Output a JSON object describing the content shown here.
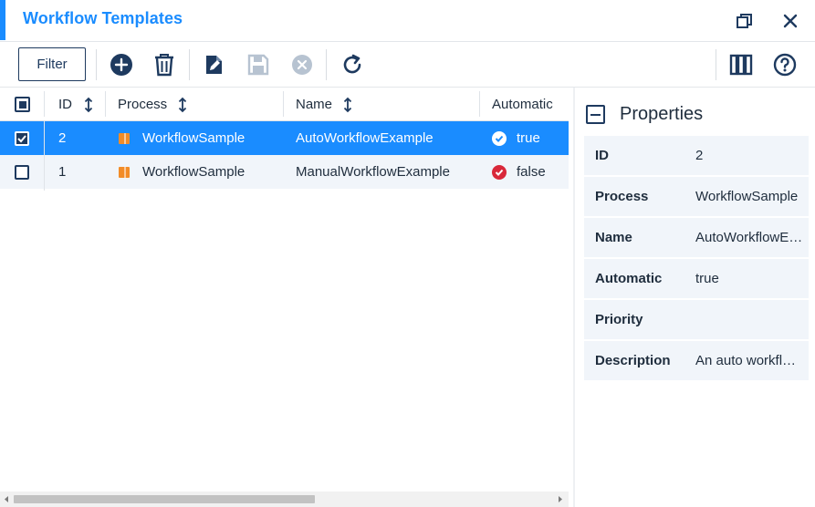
{
  "window": {
    "title": "Workflow Templates"
  },
  "toolbar": {
    "filter_label": "Filter"
  },
  "grid": {
    "columns": [
      "ID",
      "Process",
      "Name",
      "Automatic"
    ],
    "rows": [
      {
        "id": "2",
        "process": "WorkflowSample",
        "name": "AutoWorkflowExample",
        "automatic": "true",
        "checked": true
      },
      {
        "id": "1",
        "process": "WorkflowSample",
        "name": "ManualWorkflowExample",
        "automatic": "false",
        "checked": false
      }
    ]
  },
  "properties": {
    "title": "Properties",
    "items": [
      {
        "label": "ID",
        "value": "2"
      },
      {
        "label": "Process",
        "value": "WorkflowSample"
      },
      {
        "label": "Name",
        "value": "AutoWorkflowExample"
      },
      {
        "label": "Automatic",
        "value": "true"
      },
      {
        "label": "Priority",
        "value": ""
      },
      {
        "label": "Description",
        "value": "An auto workflow example"
      }
    ]
  },
  "colors": {
    "accent": "#1a8cff",
    "dark": "#1e3a5f",
    "success": "#1a8cff",
    "error": "#d9283a",
    "process_icon": "#f28c28"
  },
  "icons": {
    "restore": "restore-window-icon",
    "close": "close-icon",
    "add": "add-circle-icon",
    "delete": "trash-icon",
    "edit": "edit-document-icon",
    "save": "save-icon",
    "cancel": "cancel-circle-icon",
    "refresh": "refresh-icon",
    "columns": "columns-icon",
    "help": "help-icon"
  }
}
